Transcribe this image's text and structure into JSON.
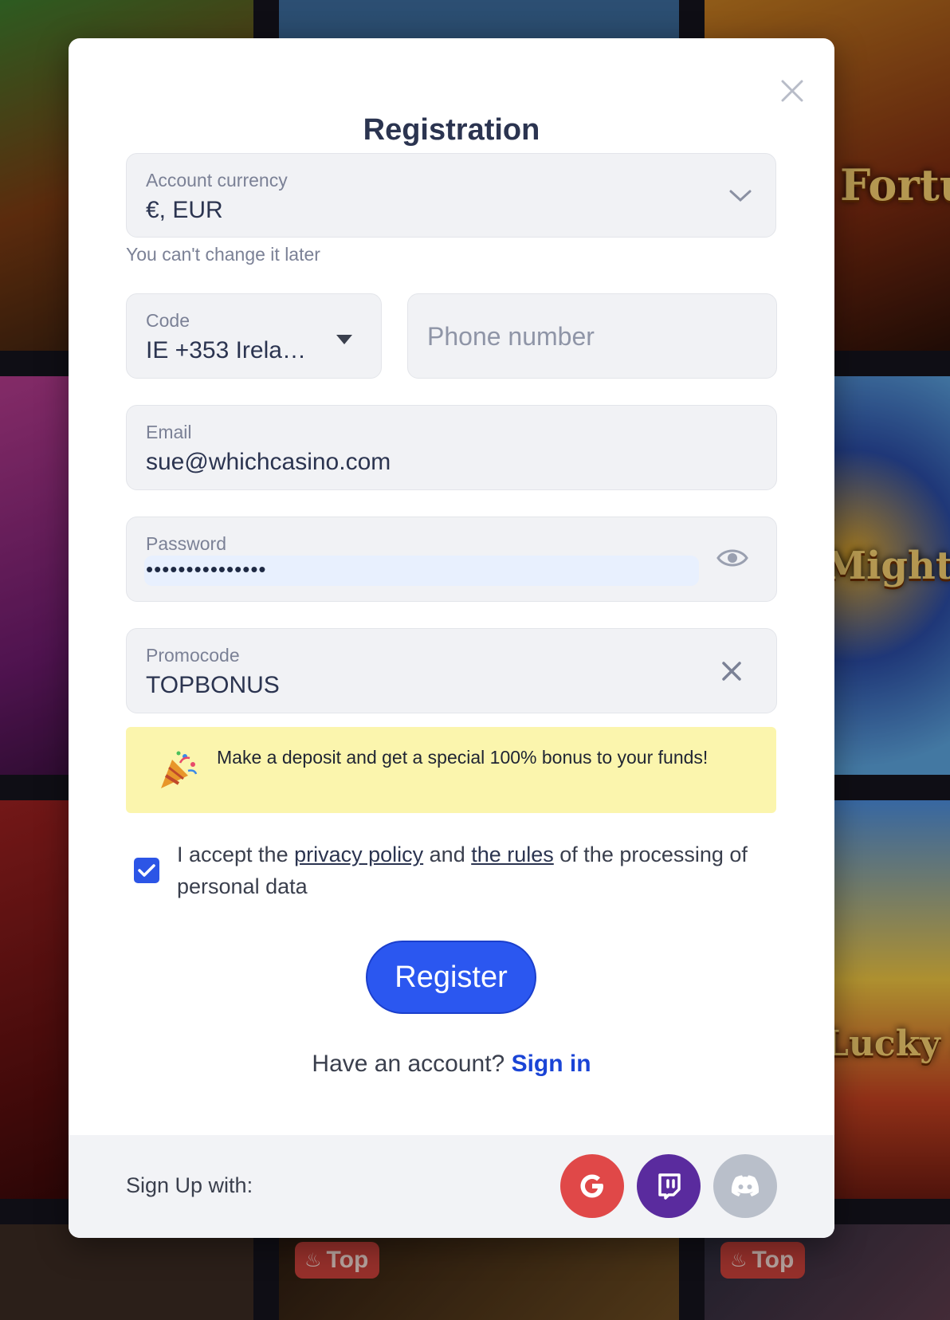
{
  "background": {
    "tiles": [
      "Fortune Reels",
      "Might of Zeus",
      "Lucky Farm Bonanza"
    ],
    "badge_label": "Top"
  },
  "modal": {
    "title": "Registration",
    "close_icon": "close-icon"
  },
  "currency": {
    "label": "Account currency",
    "value": "€, EUR",
    "hint": "You can't change it later"
  },
  "phone": {
    "code_label": "Code",
    "code_value": "IE +353 Irela…",
    "number_placeholder": "Phone number"
  },
  "email": {
    "label": "Email",
    "value": "sue@whichcasino.com"
  },
  "password": {
    "label": "Password",
    "value": "•••••••••••••••"
  },
  "promocode": {
    "label": "Promocode",
    "value": "TOPBONUS"
  },
  "promo_banner": {
    "icon": "party-popper-icon",
    "text": "Make a deposit and get a special 100% bonus to your funds!"
  },
  "consent": {
    "checked": true,
    "prefix": "I accept the ",
    "privacy_link": "privacy policy",
    "middle": " and ",
    "rules_link": "the rules",
    "suffix": " of the processing of personal data"
  },
  "register_button": "Register",
  "signin": {
    "prompt": "Have an account? ",
    "link": "Sign in"
  },
  "footer": {
    "label": "Sign Up with:",
    "providers": [
      "google",
      "twitch",
      "discord"
    ]
  },
  "colors": {
    "primary": "#2b57f0",
    "google": "#e04848",
    "twitch": "#5a2b9e",
    "discord": "#b9bfca",
    "banner": "#fbf5ad"
  }
}
